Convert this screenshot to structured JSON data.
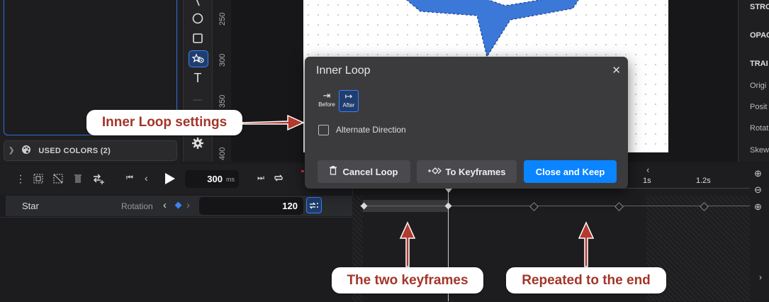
{
  "sidebar": {
    "used_colors_label": "USED COLORS (2)"
  },
  "ruler_labels": [
    "250",
    "300",
    "350",
    "400"
  ],
  "right_panel": {
    "items": [
      "STRO",
      "OPAC",
      "TRAI",
      "Origi",
      "Posit",
      "Rotat",
      "Skew"
    ]
  },
  "dialog": {
    "title": "Inner Loop",
    "before_label": "Before",
    "after_label": "After",
    "alternate_label": "Alternate Direction",
    "cancel_label": "Cancel Loop",
    "to_keyframes_label": "To Keyframes",
    "close_keep_label": "Close and Keep"
  },
  "timeline": {
    "duration_value": "300",
    "duration_unit": "ms",
    "layer_name": "Star",
    "property_name": "Rotation",
    "property_value": "120",
    "time_marks": [
      "1s",
      "1.2s"
    ]
  },
  "callouts": {
    "inner_loop": "Inner Loop settings",
    "two_keyframes": "The two keyframes",
    "repeated": "Repeated to the end"
  },
  "colors": {
    "accent": "#0a84ff",
    "callout_text": "#a33529",
    "star_fill": "#3b78d8"
  }
}
